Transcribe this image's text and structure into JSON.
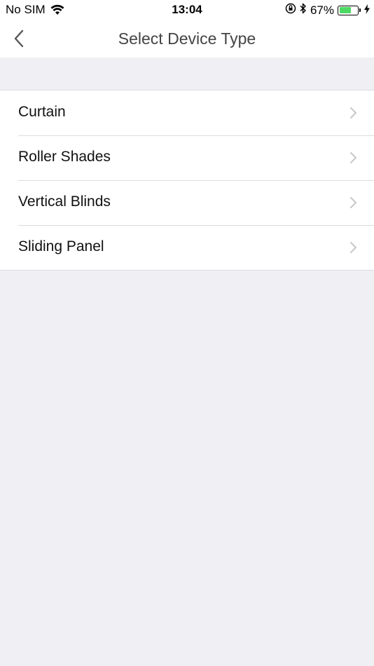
{
  "status_bar": {
    "carrier": "No SIM",
    "time": "13:04",
    "battery_percent": "67%",
    "battery_level": 0.67,
    "icons": [
      "wifi-icon",
      "orientation-lock-icon",
      "bluetooth-icon",
      "battery-icon",
      "charging-icon"
    ]
  },
  "nav": {
    "title": "Select Device Type",
    "back_icon": "chevron-left-icon"
  },
  "device_types": [
    {
      "label": "Curtain"
    },
    {
      "label": "Roller Shades"
    },
    {
      "label": "Vertical Blinds"
    },
    {
      "label": "Sliding Panel"
    }
  ],
  "colors": {
    "background": "#efeff4",
    "battery_fill": "#4cd964",
    "chevron": "#c7c7cc"
  }
}
